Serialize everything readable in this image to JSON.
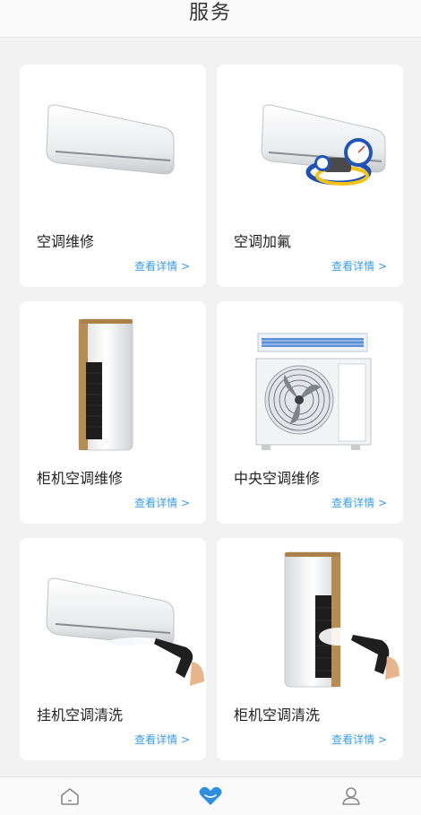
{
  "header": {
    "title": "服务"
  },
  "services": [
    {
      "name": "空调维修",
      "more": "查看详情 >",
      "icon": "wall-ac-icon"
    },
    {
      "name": "空调加氟",
      "more": "查看详情 >",
      "icon": "ac-refrigerant-gauge-icon"
    },
    {
      "name": "柜机空调维修",
      "more": "查看详情 >",
      "icon": "floor-ac-icon"
    },
    {
      "name": "中央空调维修",
      "more": "查看详情 >",
      "icon": "central-ac-unit-icon"
    },
    {
      "name": "挂机空调清洗",
      "more": "查看详情 >",
      "icon": "wall-ac-cleaning-icon"
    },
    {
      "name": "柜机空调清洗",
      "more": "查看详情 >",
      "icon": "floor-ac-cleaning-icon"
    }
  ],
  "tabbar": {
    "items": [
      "home-icon",
      "heart-icon",
      "user-icon"
    ],
    "active_color": "#2e8fe0",
    "inactive_color": "#888888"
  }
}
